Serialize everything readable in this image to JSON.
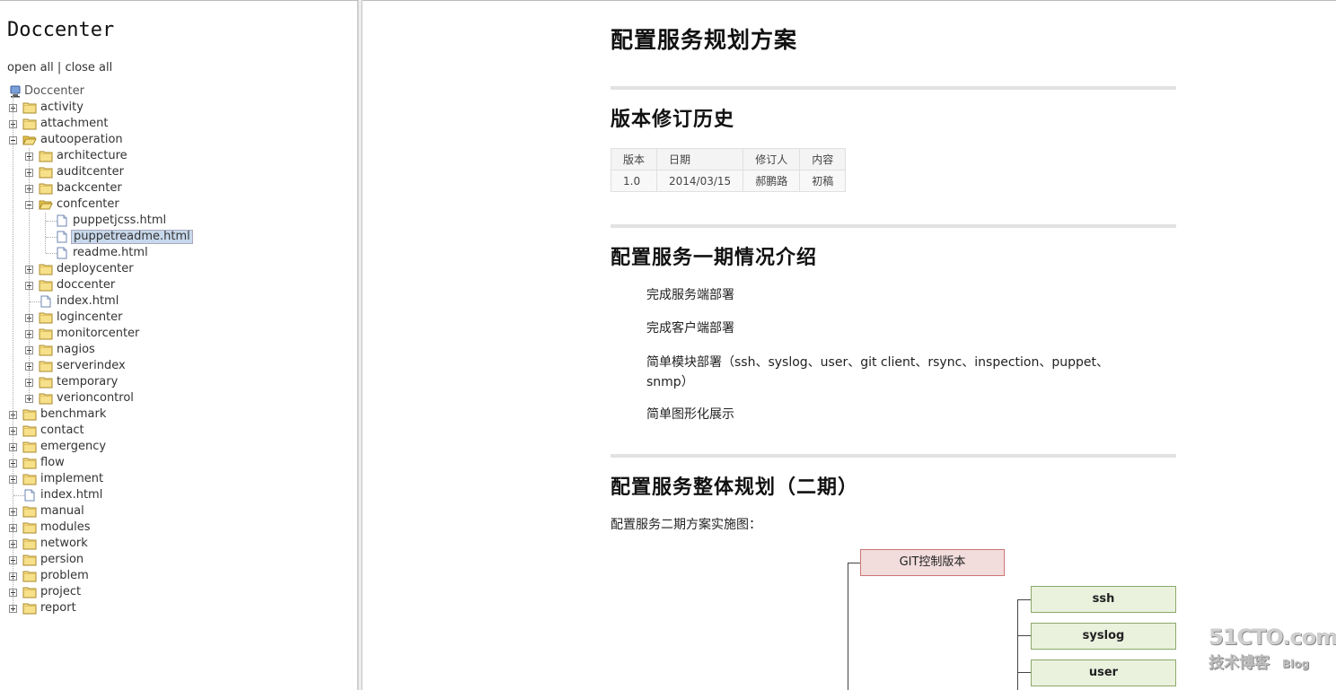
{
  "sidebar": {
    "title": "Doccenter",
    "open_all": "open all",
    "separator": "|",
    "close_all": "close all",
    "root_label": "Doccenter",
    "tree": [
      {
        "label": "activity",
        "depth": 0,
        "type": "folder",
        "state": "closed"
      },
      {
        "label": "attachment",
        "depth": 0,
        "type": "folder",
        "state": "closed"
      },
      {
        "label": "autooperation",
        "depth": 0,
        "type": "folder",
        "state": "open"
      },
      {
        "label": "architecture",
        "depth": 1,
        "type": "folder",
        "state": "closed"
      },
      {
        "label": "auditcenter",
        "depth": 1,
        "type": "folder",
        "state": "closed"
      },
      {
        "label": "backcenter",
        "depth": 1,
        "type": "folder",
        "state": "closed"
      },
      {
        "label": "confcenter",
        "depth": 1,
        "type": "folder",
        "state": "open"
      },
      {
        "label": "puppetjcss.html",
        "depth": 2,
        "type": "file"
      },
      {
        "label": "puppetreadme.html",
        "depth": 2,
        "type": "file",
        "selected": true
      },
      {
        "label": "readme.html",
        "depth": 2,
        "type": "file"
      },
      {
        "label": "deploycenter",
        "depth": 1,
        "type": "folder",
        "state": "closed"
      },
      {
        "label": "doccenter",
        "depth": 1,
        "type": "folder",
        "state": "closed"
      },
      {
        "label": "index.html",
        "depth": 1,
        "type": "file"
      },
      {
        "label": "logincenter",
        "depth": 1,
        "type": "folder",
        "state": "closed"
      },
      {
        "label": "monitorcenter",
        "depth": 1,
        "type": "folder",
        "state": "closed"
      },
      {
        "label": "nagios",
        "depth": 1,
        "type": "folder",
        "state": "closed"
      },
      {
        "label": "serverindex",
        "depth": 1,
        "type": "folder",
        "state": "closed"
      },
      {
        "label": "temporary",
        "depth": 1,
        "type": "folder",
        "state": "closed"
      },
      {
        "label": "verioncontrol",
        "depth": 1,
        "type": "folder",
        "state": "closed"
      },
      {
        "label": "benchmark",
        "depth": 0,
        "type": "folder",
        "state": "closed"
      },
      {
        "label": "contact",
        "depth": 0,
        "type": "folder",
        "state": "closed"
      },
      {
        "label": "emergency",
        "depth": 0,
        "type": "folder",
        "state": "closed"
      },
      {
        "label": "flow",
        "depth": 0,
        "type": "folder",
        "state": "closed"
      },
      {
        "label": "implement",
        "depth": 0,
        "type": "folder",
        "state": "closed"
      },
      {
        "label": "index.html",
        "depth": 0,
        "type": "file"
      },
      {
        "label": "manual",
        "depth": 0,
        "type": "folder",
        "state": "closed"
      },
      {
        "label": "modules",
        "depth": 0,
        "type": "folder",
        "state": "closed"
      },
      {
        "label": "network",
        "depth": 0,
        "type": "folder",
        "state": "closed"
      },
      {
        "label": "persion",
        "depth": 0,
        "type": "folder",
        "state": "closed"
      },
      {
        "label": "problem",
        "depth": 0,
        "type": "folder",
        "state": "closed"
      },
      {
        "label": "project",
        "depth": 0,
        "type": "folder",
        "state": "closed"
      },
      {
        "label": "report",
        "depth": 0,
        "type": "folder",
        "state": "closed"
      }
    ]
  },
  "content": {
    "title": "配置服务规划方案",
    "section1": {
      "heading": "版本修订历史",
      "table": {
        "headers": [
          "版本",
          "日期",
          "修订人",
          "内容"
        ],
        "rows": [
          [
            "1.0",
            "2014/03/15",
            "郝鹏路",
            "初稿"
          ]
        ]
      }
    },
    "section2": {
      "heading": "配置服务一期情况介绍",
      "items": [
        "完成服务端部署",
        "完成客户端部署",
        "简单模块部署（ssh、syslog、user、git client、rsync、inspection、puppet、snmp）",
        "简单图形化展示"
      ]
    },
    "section3": {
      "heading": "配置服务整体规划（二期）",
      "intro": "配置服务二期方案实施图：",
      "diagram": {
        "root": "GIT控制版本",
        "modules": [
          "ssh",
          "syslog",
          "user"
        ]
      }
    }
  },
  "watermark": {
    "main": "51CTO.com",
    "sub": "技术博客",
    "blog": "Blog"
  },
  "colors": {
    "selected_bg": "#c8d8ec",
    "folder_yellow": "#f7e08a",
    "git_box": "#f2dcdc",
    "module_box": "#eaf1dd"
  }
}
